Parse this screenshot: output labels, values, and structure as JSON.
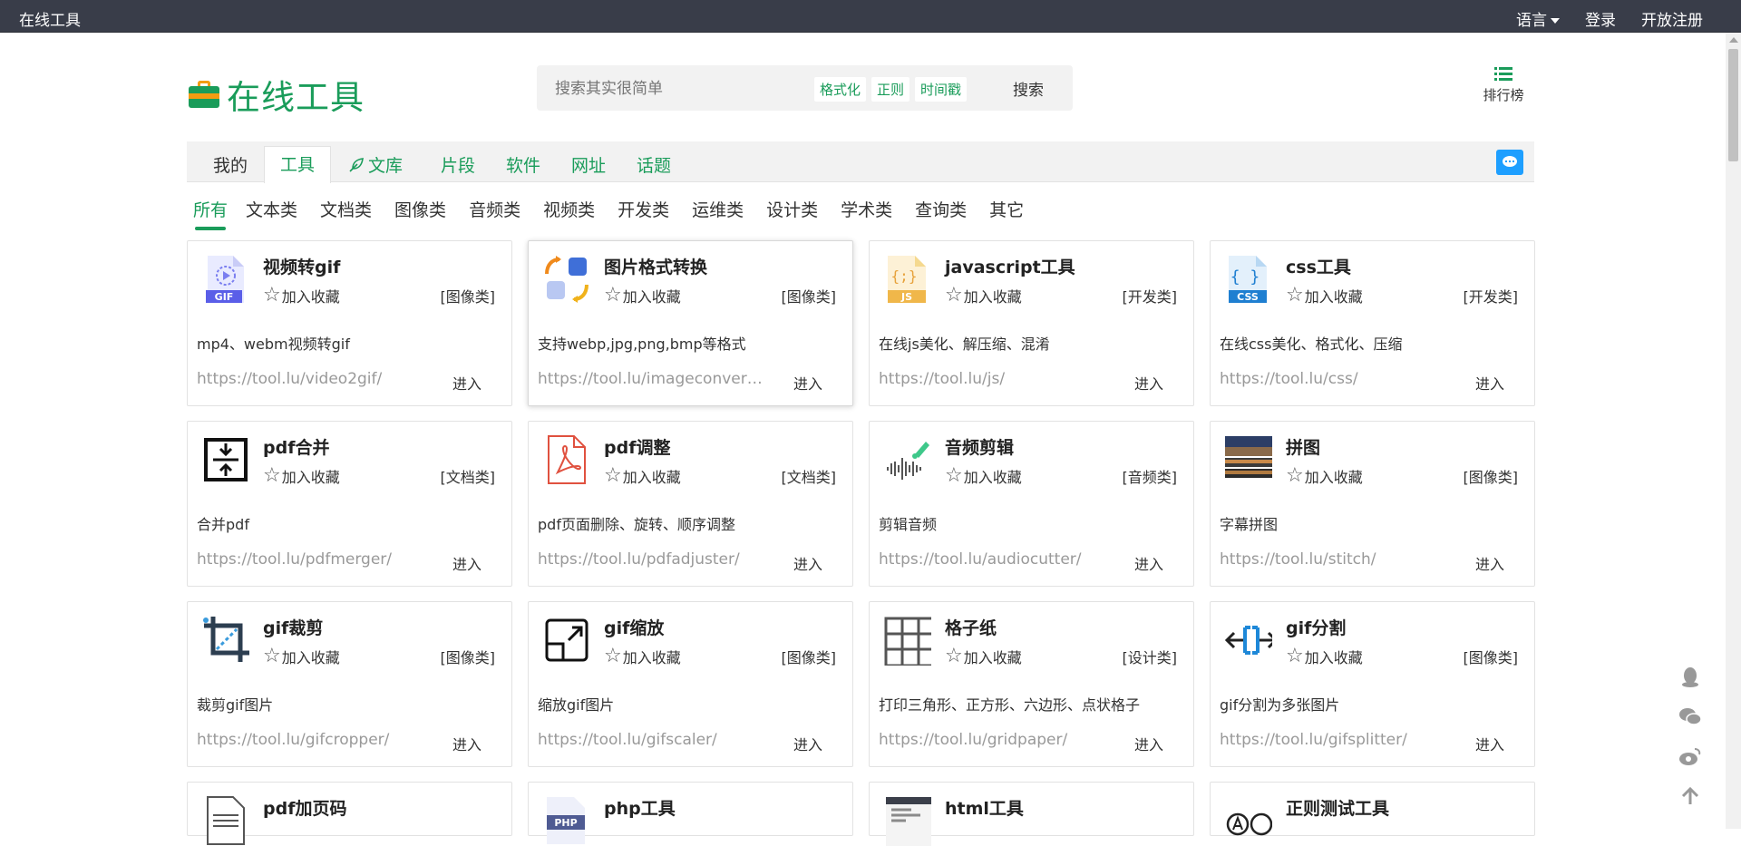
{
  "topbar": {
    "brand": "在线工具",
    "language": "语言",
    "login": "登录",
    "register": "开放注册"
  },
  "header": {
    "logo_text": "在线工具",
    "search_placeholder": "搜索其实很简单",
    "search_tags": [
      "格式化",
      "正则",
      "时间戳"
    ],
    "search_button": "搜索",
    "rank_label": "排行榜"
  },
  "nav": {
    "mine": "我的",
    "tools": "工具",
    "library": "文库",
    "snippets": "片段",
    "software": "软件",
    "urls": "网址",
    "topics": "话题"
  },
  "subtabs": [
    "所有",
    "文本类",
    "文档类",
    "图像类",
    "音频类",
    "视频类",
    "开发类",
    "运维类",
    "设计类",
    "学术类",
    "查询类",
    "其它"
  ],
  "fav_label": "加入收藏",
  "enter_label": "进入",
  "cards": [
    {
      "title": "视频转gif",
      "category": "[图像类]",
      "desc": "mp4、webm视频转gif",
      "url": "https://tool.lu/video2gif/",
      "icon": "gif-file-icon"
    },
    {
      "title": "图片格式转换",
      "category": "[图像类]",
      "desc": "支持webp,jpg,png,bmp等格式",
      "url": "https://tool.lu/imageconverter/",
      "icon": "image-convert-icon"
    },
    {
      "title": "javascript工具",
      "category": "[开发类]",
      "desc": "在线js美化、解压缩、混淆",
      "url": "https://tool.lu/js/",
      "icon": "js-file-icon"
    },
    {
      "title": "css工具",
      "category": "[开发类]",
      "desc": "在线css美化、格式化、压缩",
      "url": "https://tool.lu/css/",
      "icon": "css-file-icon"
    },
    {
      "title": "pdf合并",
      "category": "[文档类]",
      "desc": "合并pdf",
      "url": "https://tool.lu/pdfmerger/",
      "icon": "merge-icon"
    },
    {
      "title": "pdf调整",
      "category": "[文档类]",
      "desc": "pdf页面删除、旋转、顺序调整",
      "url": "https://tool.lu/pdfadjuster/",
      "icon": "pdf-file-icon"
    },
    {
      "title": "音频剪辑",
      "category": "[音频类]",
      "desc": "剪辑音频",
      "url": "https://tool.lu/audiocutter/",
      "icon": "audio-wave-icon"
    },
    {
      "title": "拼图",
      "category": "[图像类]",
      "desc": "字幕拼图",
      "url": "https://tool.lu/stitch/",
      "icon": "photo-stitch-icon"
    },
    {
      "title": "gif裁剪",
      "category": "[图像类]",
      "desc": "裁剪gif图片",
      "url": "https://tool.lu/gifcropper/",
      "icon": "crop-icon"
    },
    {
      "title": "gif缩放",
      "category": "[图像类]",
      "desc": "缩放gif图片",
      "url": "https://tool.lu/gifscaler/",
      "icon": "scale-icon"
    },
    {
      "title": "格子纸",
      "category": "[设计类]",
      "desc": "打印三角形、正方形、六边形、点状格子",
      "url": "https://tool.lu/gridpaper/",
      "icon": "grid-icon"
    },
    {
      "title": "gif分割",
      "category": "[图像类]",
      "desc": "gif分割为多张图片",
      "url": "https://tool.lu/gifsplitter/",
      "icon": "split-icon"
    },
    {
      "title": "pdf加页码",
      "category": "",
      "desc": "",
      "url": "",
      "icon": "pdf-page-number-icon"
    },
    {
      "title": "php工具",
      "category": "",
      "desc": "",
      "url": "",
      "icon": "php-file-icon"
    },
    {
      "title": "html工具",
      "category": "",
      "desc": "",
      "url": "",
      "icon": "html-code-icon"
    },
    {
      "title": "正则测试工具",
      "category": "",
      "desc": "",
      "url": "",
      "icon": "regex-icon"
    }
  ]
}
